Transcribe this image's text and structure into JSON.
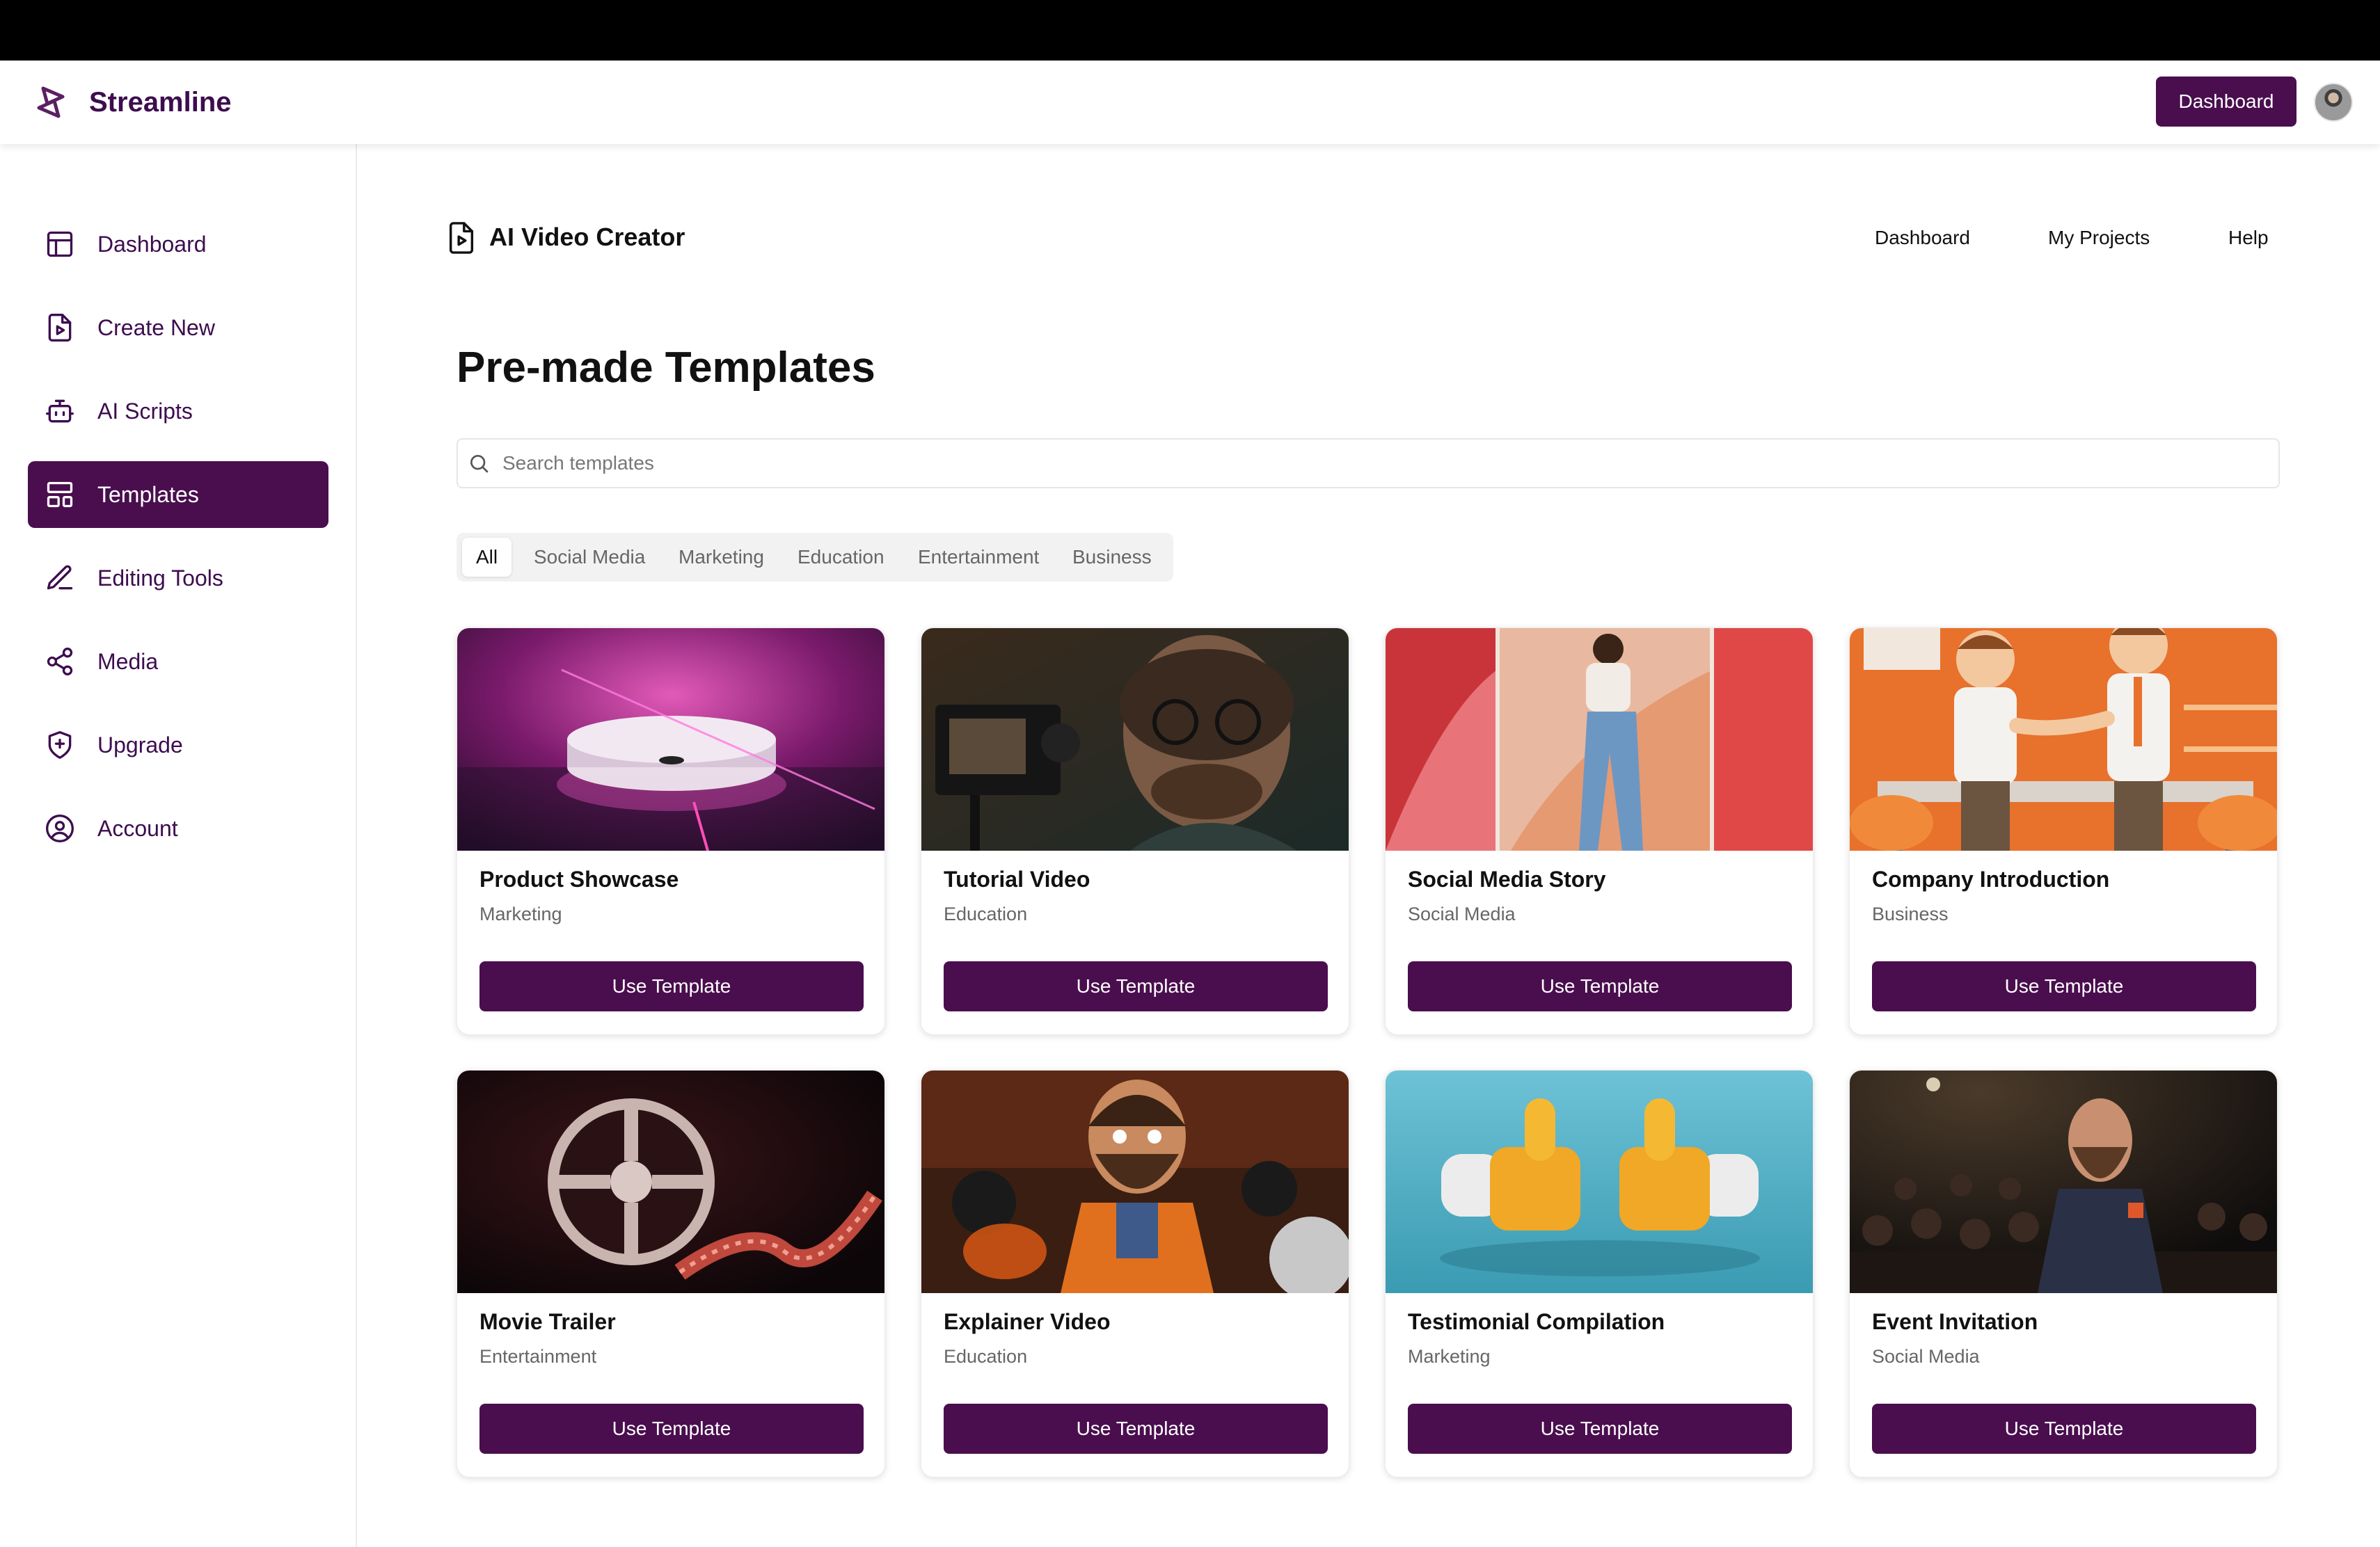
{
  "app": {
    "brand": "Streamline",
    "accent": "#4a0e4e",
    "brand_text_color": "#3d0d4f"
  },
  "topbar": {
    "dashboard_button": "Dashboard"
  },
  "sidebar": {
    "items": [
      {
        "label": "Dashboard",
        "icon": "layout-icon",
        "active": false
      },
      {
        "label": "Create New",
        "icon": "file-play-icon",
        "active": false
      },
      {
        "label": "AI Scripts",
        "icon": "robot-icon",
        "active": false
      },
      {
        "label": "Templates",
        "icon": "templates-icon",
        "active": true
      },
      {
        "label": "Editing Tools",
        "icon": "pen-icon",
        "active": false
      },
      {
        "label": "Media",
        "icon": "share-icon",
        "active": false
      },
      {
        "label": "Upgrade",
        "icon": "shield-plus-icon",
        "active": false
      },
      {
        "label": "Account",
        "icon": "user-circle-icon",
        "active": false
      }
    ]
  },
  "main": {
    "header_title": "AI Video Creator",
    "header_links": [
      "Dashboard",
      "My Projects",
      "Help"
    ],
    "page_title": "Pre-made Templates",
    "search": {
      "placeholder": "Search templates",
      "value": ""
    },
    "filters": [
      "All",
      "Social Media",
      "Marketing",
      "Education",
      "Entertainment",
      "Business"
    ],
    "active_filter": "All",
    "cards": [
      {
        "title": "Product Showcase",
        "category": "Marketing",
        "button": "Use Template"
      },
      {
        "title": "Tutorial Video",
        "category": "Education",
        "button": "Use Template"
      },
      {
        "title": "Social Media Story",
        "category": "Social Media",
        "button": "Use Template"
      },
      {
        "title": "Company Introduction",
        "category": "Business",
        "button": "Use Template"
      },
      {
        "title": "Movie Trailer",
        "category": "Entertainment",
        "button": "Use Template"
      },
      {
        "title": "Explainer Video",
        "category": "Education",
        "button": "Use Template"
      },
      {
        "title": "Testimonial Compilation",
        "category": "Marketing",
        "button": "Use Template"
      },
      {
        "title": "Event Invitation",
        "category": "Social Media",
        "button": "Use Template"
      }
    ]
  }
}
